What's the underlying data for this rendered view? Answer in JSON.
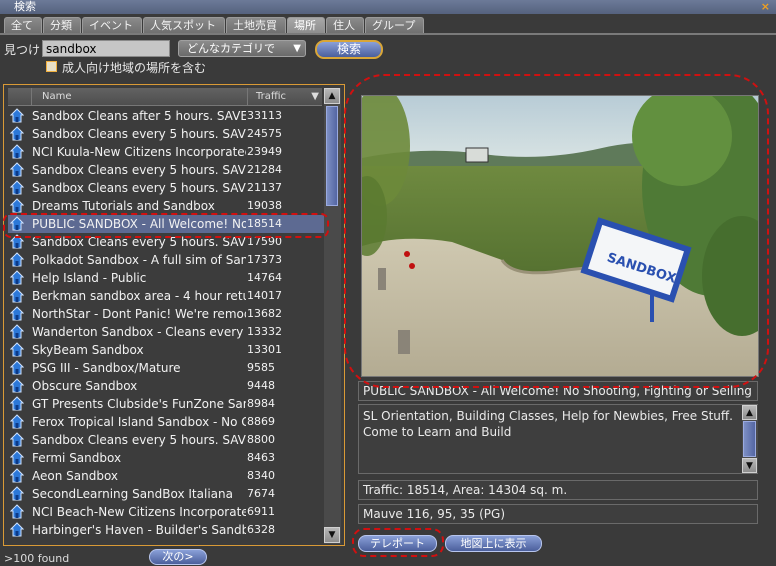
{
  "window": {
    "title": "検索",
    "close_label": "×"
  },
  "tabs": [
    {
      "label": "全て"
    },
    {
      "label": "分類"
    },
    {
      "label": "イベント"
    },
    {
      "label": "人気スポット"
    },
    {
      "label": "土地売買"
    },
    {
      "label": "場所",
      "active": true
    },
    {
      "label": "住人"
    },
    {
      "label": "グループ"
    }
  ],
  "search": {
    "find_label": "見つけ",
    "query": "sandbox",
    "category": "どんなカテゴリで",
    "search_button": "検索",
    "adult_label": "成人向け地域の場所を含む",
    "adult_checked": false
  },
  "list": {
    "columns": {
      "name": "Name",
      "traffic": "Traffic"
    },
    "rows": [
      {
        "name": "Sandbox Cleans after 5 hours. SAVE ...",
        "traffic": "33113"
      },
      {
        "name": "Sandbox Cleans every 5 hours. SAVE ...",
        "traffic": "24575"
      },
      {
        "name": "NCI Kuula-New Citizens Incorporated...",
        "traffic": "23949"
      },
      {
        "name": "Sandbox Cleans every 5 hours. SAVE ...",
        "traffic": "21284"
      },
      {
        "name": "Sandbox Cleans every 5 hours. SAVE ...",
        "traffic": "21137"
      },
      {
        "name": "Dreams Tutorials and Sandbox",
        "traffic": "19038"
      },
      {
        "name": "PUBLIC SANDBOX - All Welcome! No ...",
        "traffic": "18514",
        "selected": true
      },
      {
        "name": "Sandbox Cleans every 5 hours. SAVE ...",
        "traffic": "17590"
      },
      {
        "name": "Polkadot Sandbox - A full sim of  San...",
        "traffic": "17373"
      },
      {
        "name": "Help Island - Public",
        "traffic": "14764"
      },
      {
        "name": "Berkman sandbox area - 4 hour retu...",
        "traffic": "14017"
      },
      {
        "name": "NorthStar - Dont Panic! We're remod...",
        "traffic": "13682"
      },
      {
        "name": "Wanderton Sandbox - Cleans every ...",
        "traffic": "13332"
      },
      {
        "name": "SkyBeam Sandbox",
        "traffic": "13301"
      },
      {
        "name": "PSG III - Sandbox/Mature",
        "traffic": "9585"
      },
      {
        "name": "Obscure Sandbox",
        "traffic": "9448"
      },
      {
        "name": "GT Presents Clubside's FunZone San...",
        "traffic": "8984"
      },
      {
        "name": "Ferox Tropical Island Sandbox - No G...",
        "traffic": "8869"
      },
      {
        "name": "Sandbox Cleans every 5 hours. SAVE ...",
        "traffic": "8800"
      },
      {
        "name": "Fermi Sandbox",
        "traffic": "8463"
      },
      {
        "name": "Aeon Sandbox",
        "traffic": "8340"
      },
      {
        "name": "SecondLearning  SandBox Italiana",
        "traffic": "7674"
      },
      {
        "name": "NCI Beach-New Citizens Incorporate...",
        "traffic": "6911"
      },
      {
        "name": "Harbinger's Haven - Builder's Sandbox",
        "traffic": "6328"
      }
    ],
    "found": ">100 found",
    "next_button": "次の>"
  },
  "detail": {
    "name": "PUBLIC SANDBOX - All Welcome! No Shooting, Fighting or Selling",
    "description": [
      "SL Orientation, Building Classes, Help for Newbies, Free Stuff.",
      "Come to Learn and Build"
    ],
    "traffic_area": "Traffic: 18514, Area: 14304 sq. m.",
    "location": "Mauve 116, 95, 35 (PG)",
    "snapshot_sign": "SANDBOX",
    "teleport_button": "テレポート",
    "map_button": "地図上に表示"
  },
  "icons": {
    "place": "house-icon",
    "scroll_up": "▲",
    "scroll_down": "▼",
    "sort": "▼"
  },
  "colors": {
    "selection": "#5d6a92",
    "frame_accent": "#d99a36",
    "callout": "#d01010",
    "button": "#5a6eac"
  }
}
